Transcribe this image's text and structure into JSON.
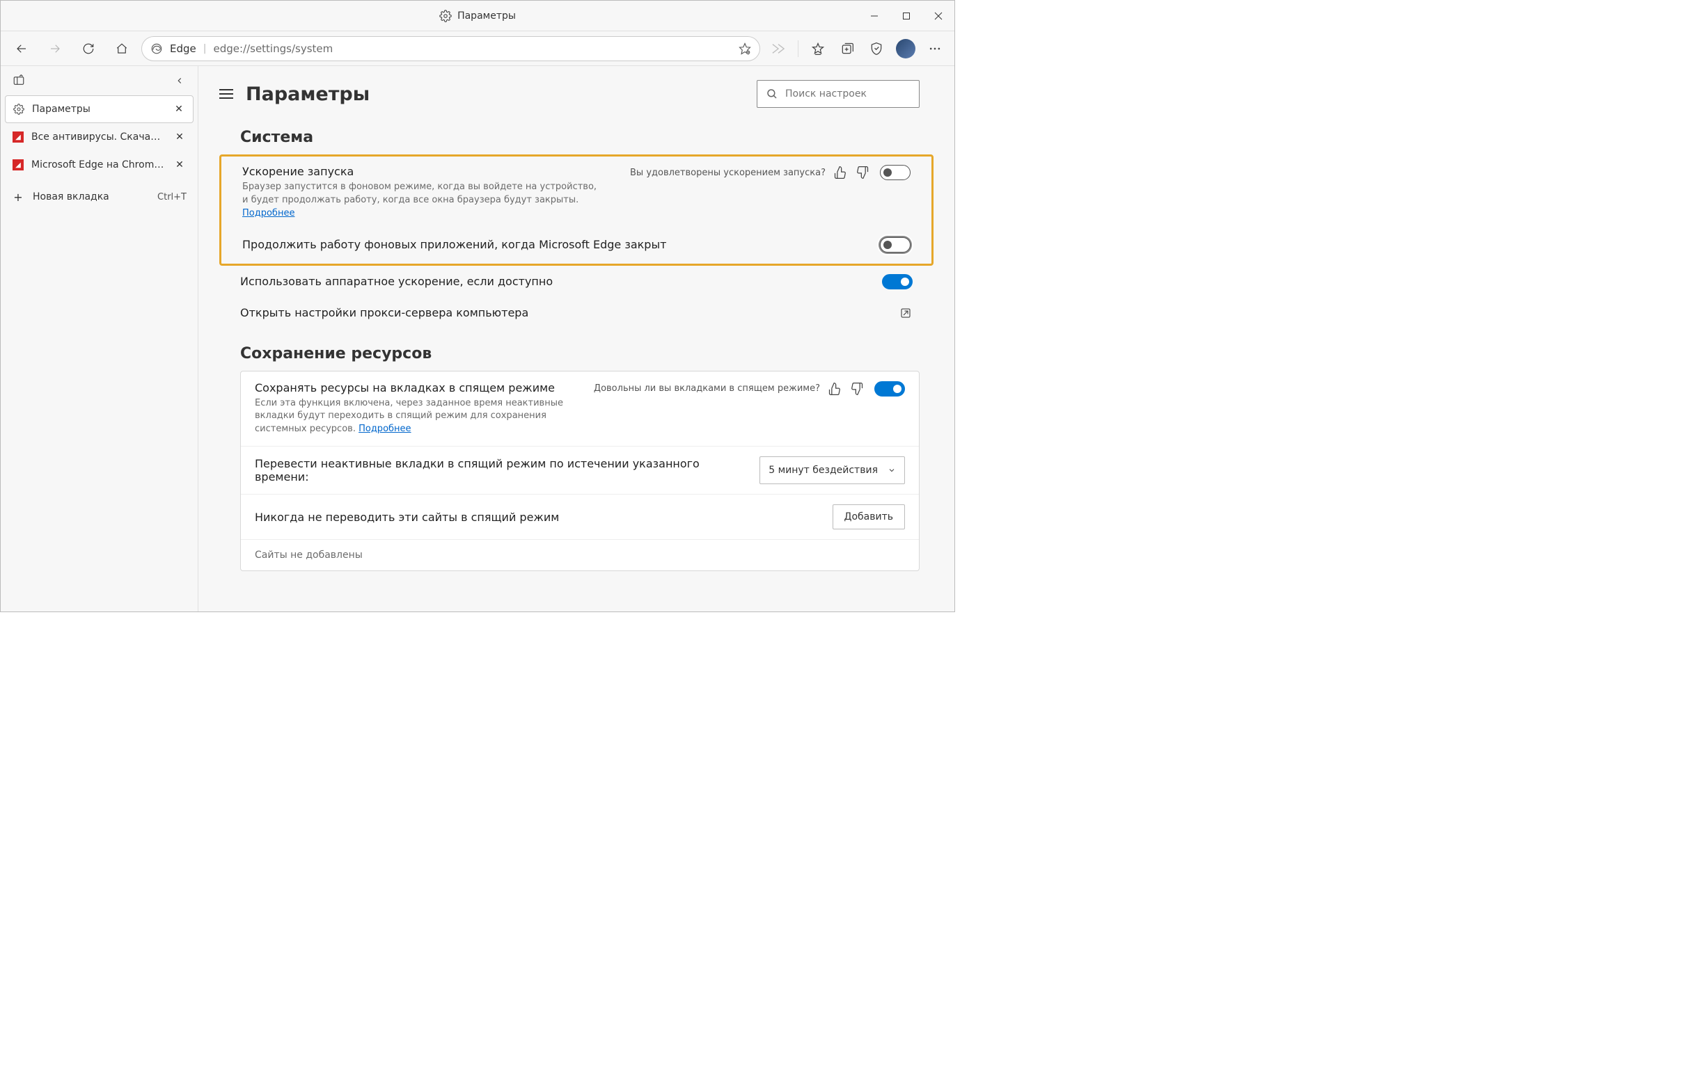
{
  "window": {
    "title": "Параметры"
  },
  "toolbar": {
    "url_prefix": "Edge",
    "url": "edge://settings/system"
  },
  "tabs": {
    "items": [
      {
        "label": "Параметры",
        "active": true
      },
      {
        "label": "Все антивирусы. Скачать беспл…",
        "active": false
      },
      {
        "label": "Microsoft Edge на Chromium – Н…",
        "active": false
      }
    ],
    "newtab_label": "Новая вкладка",
    "newtab_shortcut": "Ctrl+T"
  },
  "settings": {
    "header_title": "Параметры",
    "search_placeholder": "Поиск настроек",
    "system": {
      "section_title": "Система",
      "startup_boost": {
        "title": "Ускорение запуска",
        "desc": "Браузер запустится в фоновом режиме, когда вы войдете на устройство, и будет продолжать работу, когда все окна браузера будут закрыты.",
        "learn_more": "Подробнее",
        "feedback": "Вы удовлетворены ускорением запуска?",
        "enabled": false
      },
      "background_apps": {
        "title": "Продолжить работу фоновых приложений, когда Microsoft Edge закрыт",
        "enabled": false
      },
      "hw_accel": {
        "title": "Использовать аппаратное ускорение, если доступно",
        "enabled": true
      },
      "proxy": {
        "title": "Открыть настройки прокси-сервера компьютера"
      }
    },
    "resources": {
      "section_title": "Сохранение ресурсов",
      "sleeping_tabs": {
        "title": "Сохранять ресурсы на вкладках в спящем режиме",
        "desc": "Если эта функция включена, через заданное время неактивные вкладки будут переходить в спящий режим для сохранения системных ресурсов.",
        "learn_more": "Подробнее",
        "feedback": "Довольны ли вы вкладками в спящем режиме?",
        "enabled": true
      },
      "sleep_after": {
        "title": "Перевести неактивные вкладки в спящий режим по истечении указанного времени:",
        "value": "5 минут бездействия"
      },
      "never_sleep": {
        "title": "Никогда не переводить эти сайты в спящий режим",
        "button": "Добавить",
        "empty": "Сайты не добавлены"
      }
    }
  }
}
